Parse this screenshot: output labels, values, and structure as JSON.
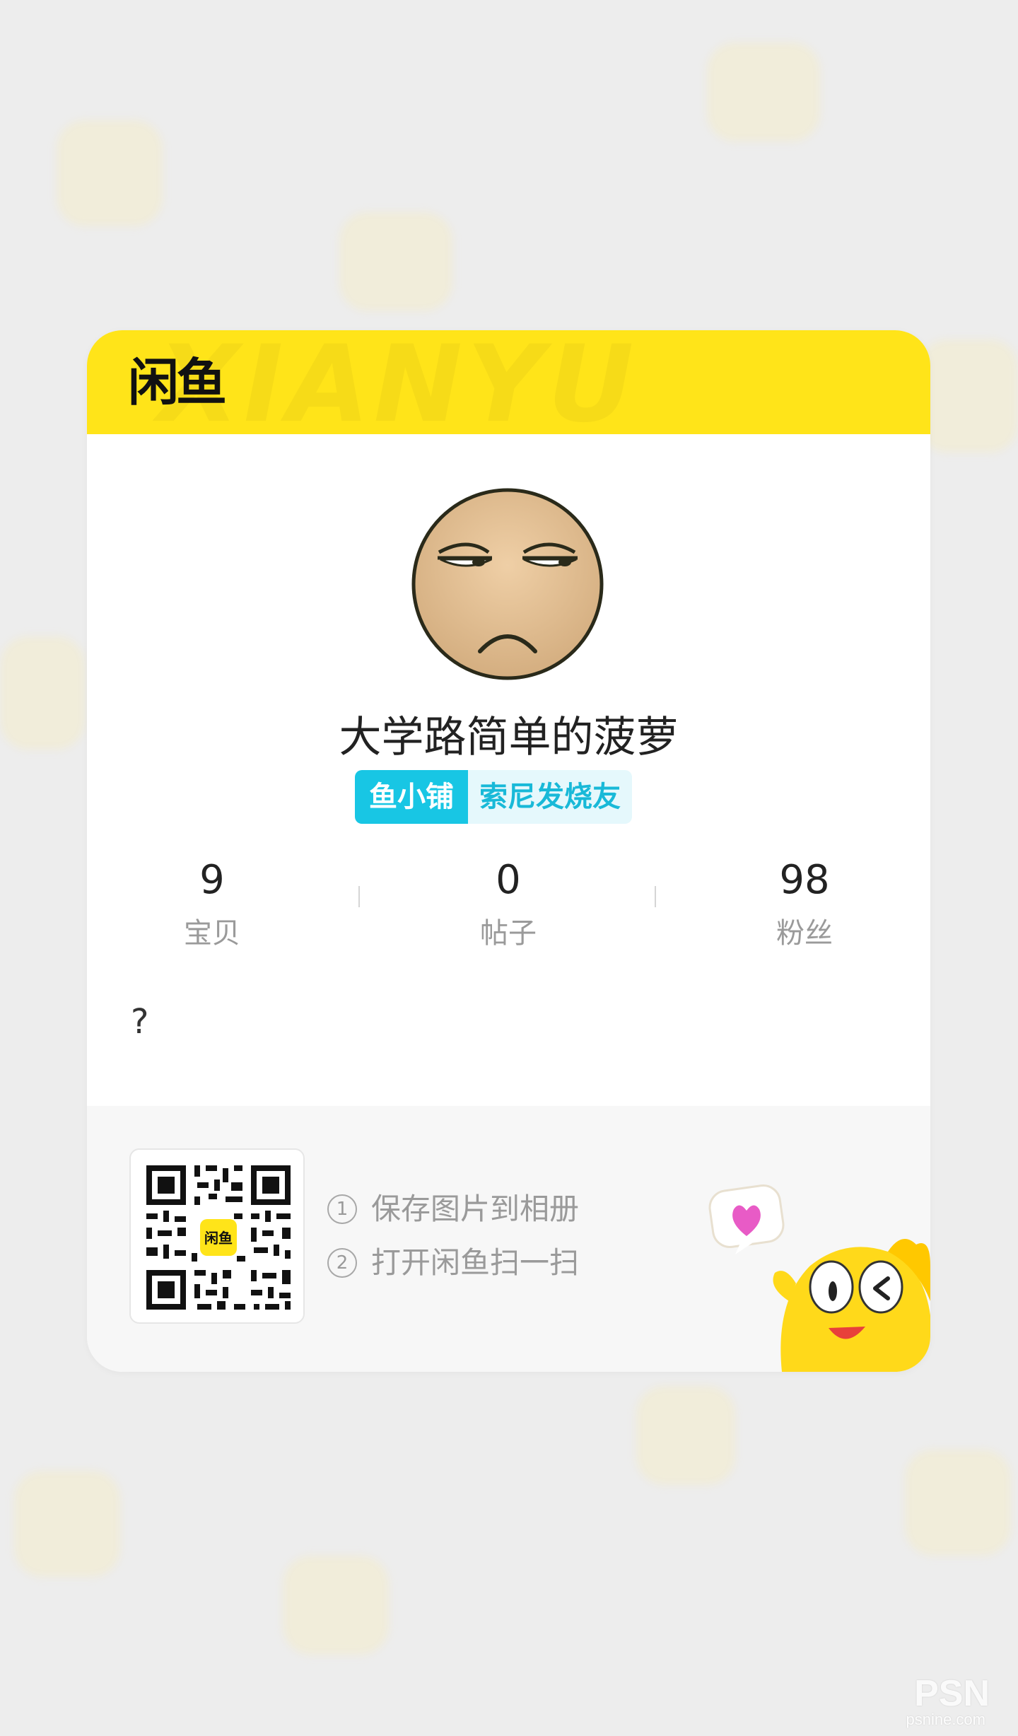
{
  "header": {
    "logo_text": "闲鱼",
    "watermark": "XIANYU"
  },
  "profile": {
    "username": "大学路简单的菠萝",
    "tag_badge": "鱼小铺",
    "tag_label": "索尼发烧友",
    "bio": "?"
  },
  "stats": [
    {
      "value": "9",
      "label": "宝贝"
    },
    {
      "value": "0",
      "label": "帖子"
    },
    {
      "value": "98",
      "label": "粉丝"
    }
  ],
  "qr": {
    "center_label": "闲鱼",
    "steps": [
      {
        "num": "1",
        "text": "保存图片到相册"
      },
      {
        "num": "2",
        "text": "打开闲鱼扫一扫"
      }
    ]
  },
  "watermark_logo": {
    "text": "PSN",
    "sub": "psnine.com"
  },
  "colors": {
    "brand_yellow": "#ffe419",
    "tag_cyan": "#18c6e4",
    "background": "#ededed"
  }
}
